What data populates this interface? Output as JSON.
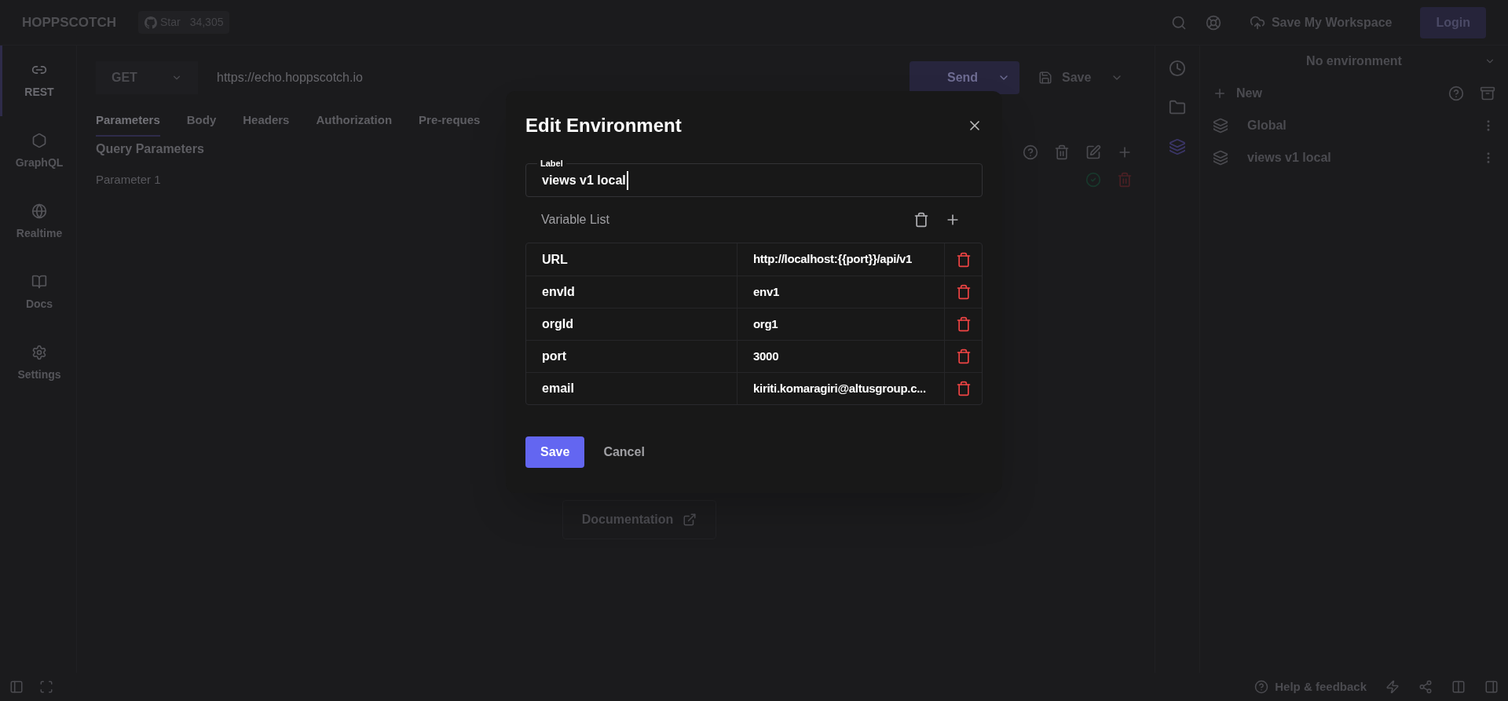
{
  "header": {
    "brand": "HOPPSCOTCH",
    "github": {
      "label": "Star",
      "count": "34,305"
    },
    "save_workspace": "Save My Workspace",
    "login": "Login"
  },
  "nav": [
    {
      "label": "REST",
      "selected": true
    },
    {
      "label": "GraphQL",
      "selected": false
    },
    {
      "label": "Realtime",
      "selected": false
    },
    {
      "label": "Docs",
      "selected": false
    },
    {
      "label": "Settings",
      "selected": false
    }
  ],
  "request": {
    "method": "GET",
    "url": "https://echo.hoppscotch.io",
    "send": "Send",
    "save": "Save"
  },
  "tabs": [
    {
      "label": "Parameters",
      "selected": true
    },
    {
      "label": "Body",
      "selected": false
    },
    {
      "label": "Headers",
      "selected": false
    },
    {
      "label": "Authorization",
      "selected": false
    },
    {
      "label": "Pre-reques",
      "selected": false
    }
  ],
  "query": {
    "title": "Query Parameters",
    "row": "Parameter 1"
  },
  "documentation": "Documentation",
  "side_strip": [
    {
      "selected": false
    },
    {
      "selected": false
    },
    {
      "selected": true
    }
  ],
  "environments": {
    "selector": "No environment",
    "new": "New",
    "items": [
      {
        "name": "Global"
      },
      {
        "name": "views v1 local"
      }
    ]
  },
  "dialog": {
    "title": "Edit Environment",
    "label": "Label",
    "value": "views v1 local",
    "variable_list": "Variable List",
    "variables": [
      {
        "key": "URL",
        "value": "http://localhost:{{port}}/api/v1"
      },
      {
        "key": "envId",
        "value": "env1"
      },
      {
        "key": "orgId",
        "value": "org1"
      },
      {
        "key": "port",
        "value": "3000"
      },
      {
        "key": "email",
        "value": "kiriti.komaragiri@altusgroup.c..."
      }
    ],
    "save": "Save",
    "cancel": "Cancel"
  },
  "footer": {
    "help": "Help & feedback"
  }
}
